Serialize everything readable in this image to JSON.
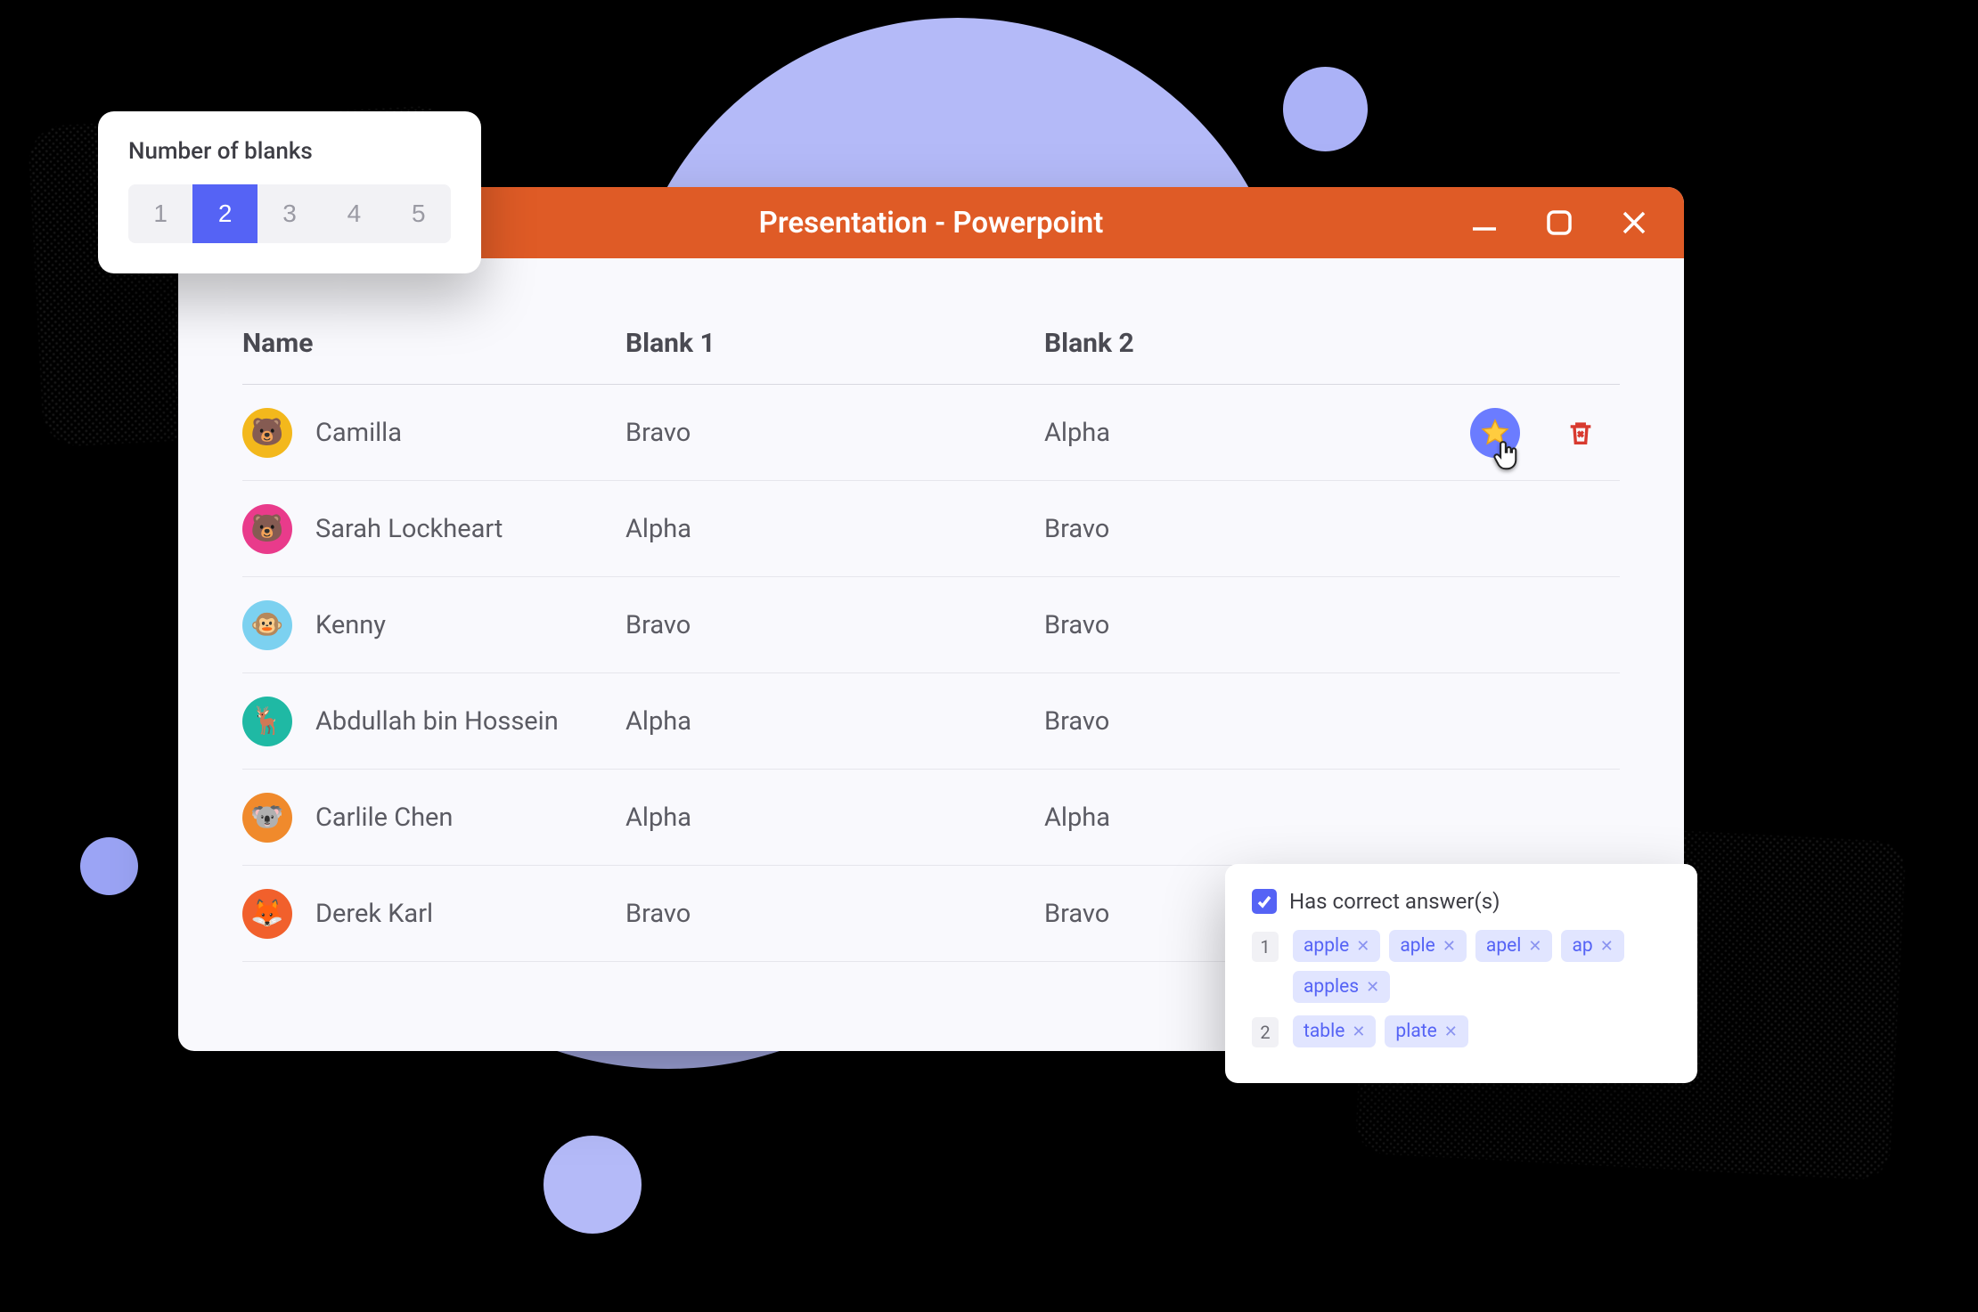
{
  "window": {
    "title": "Presentation - Powerpoint"
  },
  "columns": {
    "name": "Name",
    "blank1": "Blank 1",
    "blank2": "Blank 2"
  },
  "rows": [
    {
      "name": "Camilla",
      "b1": "Bravo",
      "b2": "Alpha",
      "avatarColor": "#f3b81c",
      "avatarEmoji": "🐻",
      "star": true,
      "trash": true
    },
    {
      "name": "Sarah Lockheart",
      "b1": "Alpha",
      "b2": "Bravo",
      "avatarColor": "#e93b8b",
      "avatarEmoji": "🐻"
    },
    {
      "name": "Kenny",
      "b1": "Bravo",
      "b2": "Bravo",
      "avatarColor": "#7cd1f0",
      "avatarEmoji": "🐵"
    },
    {
      "name": "Abdullah bin Hossein",
      "b1": "Alpha",
      "b2": "Bravo",
      "avatarColor": "#1fb9a4",
      "avatarEmoji": "🦌"
    },
    {
      "name": "Carlile Chen",
      "b1": "Alpha",
      "b2": "Alpha",
      "avatarColor": "#f08a2c",
      "avatarEmoji": "🐨"
    },
    {
      "name": "Derek Karl",
      "b1": "Bravo",
      "b2": "Bravo",
      "avatarColor": "#f1602c",
      "avatarEmoji": "🦊"
    }
  ],
  "blanksCard": {
    "title": "Number of blanks",
    "options": [
      "1",
      "2",
      "3",
      "4",
      "5"
    ],
    "activeIndex": 1
  },
  "answersCard": {
    "label": "Has correct answer(s)",
    "checked": true,
    "groups": [
      {
        "num": "1",
        "chips": [
          "apple",
          "aple",
          "apel",
          "ap",
          "apples"
        ]
      },
      {
        "num": "2",
        "chips": [
          "table",
          "plate"
        ]
      }
    ]
  }
}
